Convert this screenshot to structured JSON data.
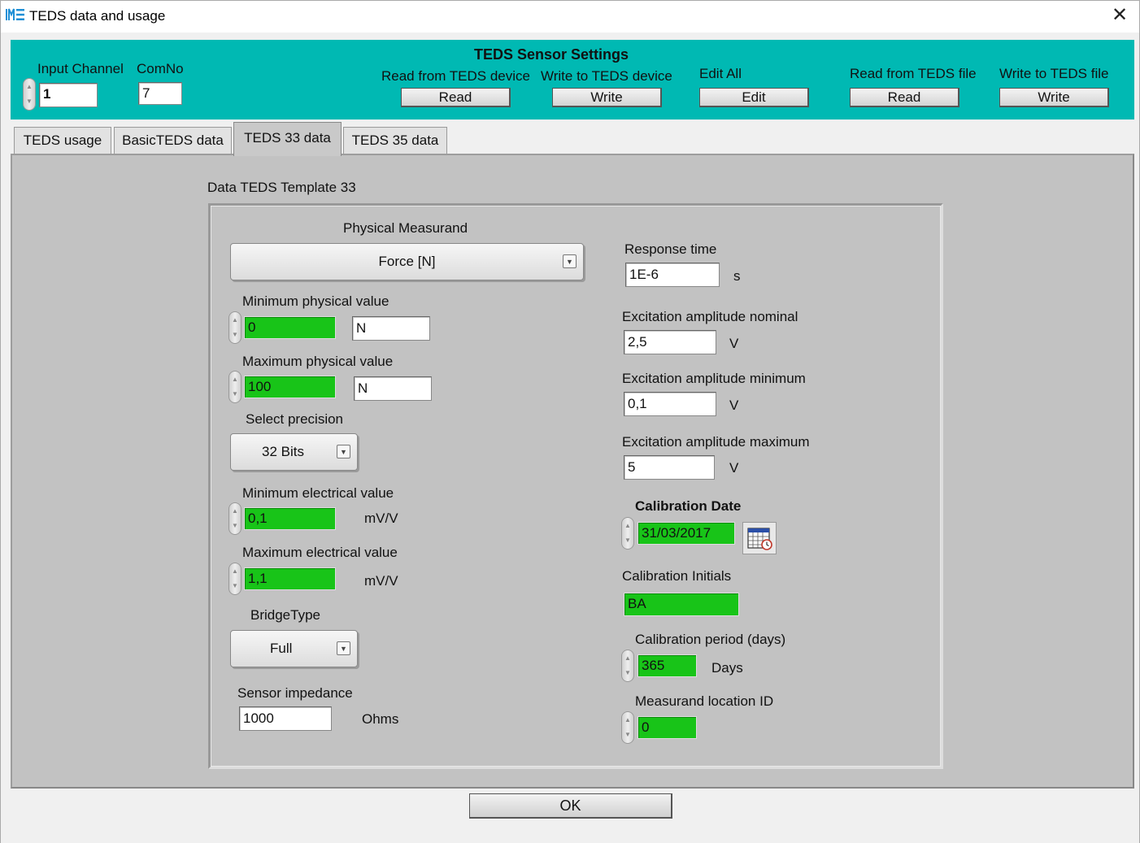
{
  "window": {
    "title": "TEDS data and usage",
    "close_glyph": "✕"
  },
  "header": {
    "title": "TEDS Sensor Settings",
    "input_channel_label": "Input Channel",
    "input_channel_value": "1",
    "comno_label": "ComNo",
    "comno_value": "7",
    "read_device_label": "Read from TEDS device",
    "read_device_button": "Read",
    "write_device_label": "Write to TEDS device",
    "write_device_button": "Write",
    "edit_all_label": "Edit All",
    "edit_button": "Edit",
    "read_file_label": "Read from TEDS file",
    "read_file_button": "Read",
    "write_file_label": "Write to TEDS file",
    "write_file_button": "Write",
    "background_color": "#00b9b3"
  },
  "tabs": [
    {
      "label": "TEDS usage",
      "active": false
    },
    {
      "label": "BasicTEDS data",
      "active": false
    },
    {
      "label": "TEDS 33 data",
      "active": true
    },
    {
      "label": "TEDS 35 data",
      "active": false
    }
  ],
  "template": {
    "title": "Data TEDS Template 33",
    "physical_measurand_label": "Physical Measurand",
    "physical_measurand_value": "Force [N]",
    "min_physical_label": "Minimum physical value",
    "min_physical_value": "0",
    "min_physical_unit": "N",
    "max_physical_label": "Maximum physical value",
    "max_physical_value": "100",
    "max_physical_unit": "N",
    "precision_label": "Select precision",
    "precision_value": "32 Bits",
    "min_electrical_label": "Minimum electrical value",
    "min_electrical_value": "0,1",
    "min_electrical_unit": "mV/V",
    "max_electrical_label": "Maximum electrical value",
    "max_electrical_value": "1,1",
    "max_electrical_unit": "mV/V",
    "bridge_label": "BridgeType",
    "bridge_value": "Full",
    "impedance_label": "Sensor impedance",
    "impedance_value": "1000",
    "impedance_unit": "Ohms",
    "response_label": "Response time",
    "response_value": "1E-6",
    "response_unit": "s",
    "exc_nominal_label": "Excitation amplitude nominal",
    "exc_nominal_value": "2,5",
    "exc_nominal_unit": "V",
    "exc_min_label": "Excitation amplitude minimum",
    "exc_min_value": "0,1",
    "exc_min_unit": "V",
    "exc_max_label": "Excitation amplitude  maximum",
    "exc_max_value": "5",
    "exc_max_unit": "V",
    "cal_date_label": "Calibration Date",
    "cal_date_value": "31/03/2017",
    "cal_initials_label": "Calibration Initials",
    "cal_initials_value": "BA",
    "cal_period_label": "Calibration period (days)",
    "cal_period_value": "365",
    "cal_period_unit": "Days",
    "location_label": "Measurand location ID",
    "location_value": "0",
    "green_color": "#18c418"
  },
  "footer": {
    "ok_button": "OK"
  }
}
